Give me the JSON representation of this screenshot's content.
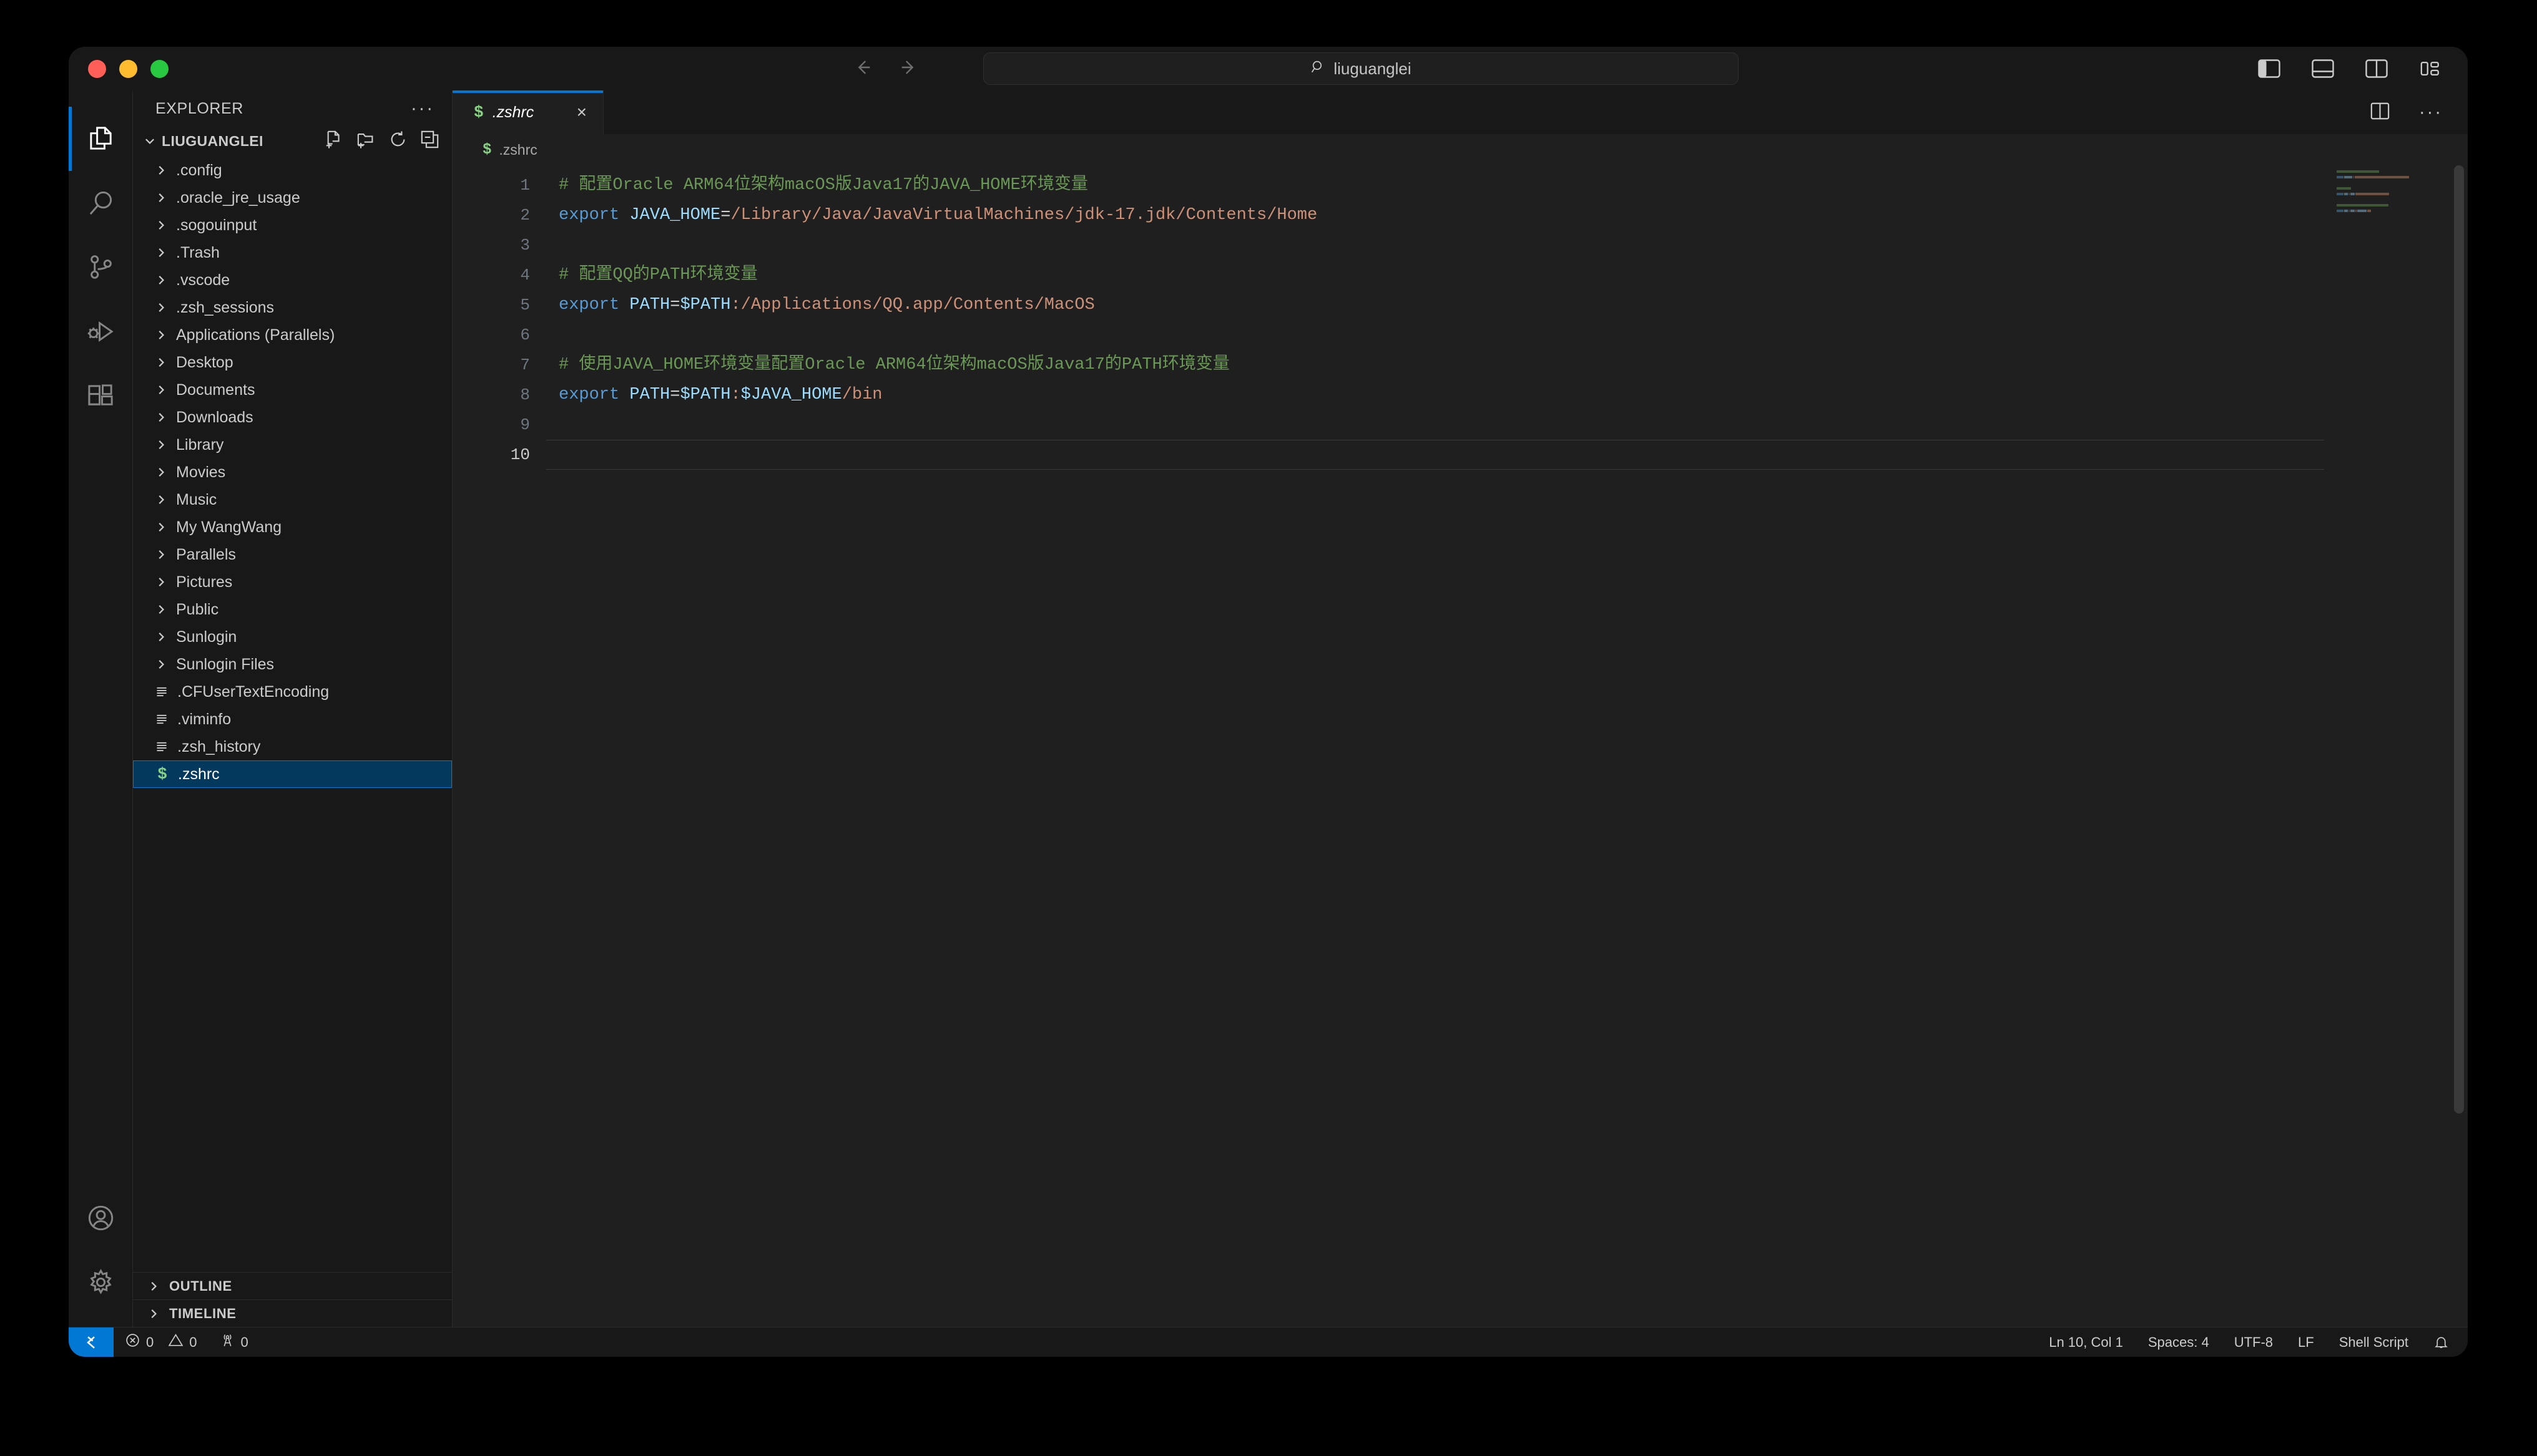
{
  "window": {
    "traffic_lights": [
      "close",
      "minimize",
      "maximize"
    ],
    "colors": {
      "close": "#ff5f57",
      "minimize": "#febc2e",
      "maximize": "#28c840",
      "accent": "#0078d4",
      "selection": "#04395e"
    }
  },
  "titlebar": {
    "back_icon": "arrow-left-icon",
    "forward_icon": "arrow-right-icon",
    "search": {
      "icon": "search-icon",
      "value": "liuguanglei"
    },
    "layout_buttons": [
      {
        "name": "toggle-primary-sidebar",
        "active": true
      },
      {
        "name": "toggle-panel",
        "active": false
      },
      {
        "name": "toggle-secondary-sidebar",
        "active": false
      },
      {
        "name": "customize-layout",
        "active": false
      }
    ]
  },
  "activitybar": {
    "items": [
      {
        "name": "explorer",
        "icon": "files-icon",
        "active": true
      },
      {
        "name": "search",
        "icon": "search-icon",
        "active": false
      },
      {
        "name": "source-control",
        "icon": "source-control-icon",
        "active": false
      },
      {
        "name": "run-and-debug",
        "icon": "debug-icon",
        "active": false
      },
      {
        "name": "extensions",
        "icon": "extensions-icon",
        "active": false
      }
    ],
    "bottom": [
      {
        "name": "accounts",
        "icon": "account-icon"
      },
      {
        "name": "manage",
        "icon": "gear-icon"
      }
    ]
  },
  "sidebar": {
    "title": "EXPLORER",
    "more_actions": "···",
    "folder": {
      "name": "LIUGUANGLEI",
      "expanded": true,
      "actions": [
        {
          "name": "new-file",
          "icon": "new-file-icon"
        },
        {
          "name": "new-folder",
          "icon": "new-folder-icon"
        },
        {
          "name": "refresh-explorer",
          "icon": "refresh-icon"
        },
        {
          "name": "collapse-folders",
          "icon": "collapse-all-icon"
        }
      ]
    },
    "items": [
      {
        "label": ".config",
        "type": "folder",
        "selected": false
      },
      {
        "label": ".oracle_jre_usage",
        "type": "folder",
        "selected": false
      },
      {
        "label": ".sogouinput",
        "type": "folder",
        "selected": false
      },
      {
        "label": ".Trash",
        "type": "folder",
        "selected": false
      },
      {
        "label": ".vscode",
        "type": "folder",
        "selected": false
      },
      {
        "label": ".zsh_sessions",
        "type": "folder",
        "selected": false
      },
      {
        "label": "Applications (Parallels)",
        "type": "folder",
        "selected": false
      },
      {
        "label": "Desktop",
        "type": "folder",
        "selected": false
      },
      {
        "label": "Documents",
        "type": "folder",
        "selected": false
      },
      {
        "label": "Downloads",
        "type": "folder",
        "selected": false
      },
      {
        "label": "Library",
        "type": "folder",
        "selected": false
      },
      {
        "label": "Movies",
        "type": "folder",
        "selected": false
      },
      {
        "label": "Music",
        "type": "folder",
        "selected": false
      },
      {
        "label": "My WangWang",
        "type": "folder",
        "selected": false
      },
      {
        "label": "Parallels",
        "type": "folder",
        "selected": false
      },
      {
        "label": "Pictures",
        "type": "folder",
        "selected": false
      },
      {
        "label": "Public",
        "type": "folder",
        "selected": false
      },
      {
        "label": "Sunlogin",
        "type": "folder",
        "selected": false
      },
      {
        "label": "Sunlogin Files",
        "type": "folder",
        "selected": false
      },
      {
        "label": ".CFUserTextEncoding",
        "type": "file",
        "selected": false
      },
      {
        "label": ".viminfo",
        "type": "file",
        "selected": false
      },
      {
        "label": ".zsh_history",
        "type": "file",
        "selected": false
      },
      {
        "label": ".zshrc",
        "type": "shell",
        "selected": true
      }
    ],
    "panels": [
      {
        "label": "OUTLINE",
        "expanded": false
      },
      {
        "label": "TIMELINE",
        "expanded": false
      }
    ]
  },
  "editor": {
    "tabs": [
      {
        "label": ".zshrc",
        "icon": "shell-file-icon",
        "active": true,
        "preview": true,
        "close": "×"
      }
    ],
    "actions": [
      {
        "name": "split-editor-right",
        "icon": "split-editor-icon"
      },
      {
        "name": "more-editor-actions",
        "icon": "ellipsis-icon",
        "label": "···"
      }
    ],
    "breadcrumb": {
      "icon": "shell-file-icon",
      "path": ".zshrc"
    },
    "line_numbers": [
      "1",
      "2",
      "3",
      "4",
      "5",
      "6",
      "7",
      "8",
      "9",
      "10"
    ],
    "active_line": 10,
    "lines": [
      {
        "n": 1,
        "tokens": [
          {
            "t": "# 配置Oracle ARM64位架构macOS版Java17的JAVA_HOME环境变量",
            "c": "comment"
          }
        ]
      },
      {
        "n": 2,
        "tokens": [
          {
            "t": "export ",
            "c": "keyword"
          },
          {
            "t": "JAVA_HOME",
            "c": "var"
          },
          {
            "t": "=",
            "c": "op"
          },
          {
            "t": "/Library/Java/JavaVirtualMachines/jdk-17.jdk/Contents/Home",
            "c": "string"
          }
        ]
      },
      {
        "n": 3,
        "tokens": []
      },
      {
        "n": 4,
        "tokens": [
          {
            "t": "# 配置QQ的PATH环境变量",
            "c": "comment"
          }
        ]
      },
      {
        "n": 5,
        "tokens": [
          {
            "t": "export ",
            "c": "keyword"
          },
          {
            "t": "PATH",
            "c": "var"
          },
          {
            "t": "=",
            "c": "op"
          },
          {
            "t": "$PATH",
            "c": "var"
          },
          {
            "t": ":/Applications/QQ.app/Contents/MacOS",
            "c": "string"
          }
        ]
      },
      {
        "n": 6,
        "tokens": []
      },
      {
        "n": 7,
        "tokens": [
          {
            "t": "# 使用JAVA_HOME环境变量配置Oracle ARM64位架构macOS版Java17的PATH环境变量",
            "c": "comment"
          }
        ]
      },
      {
        "n": 8,
        "tokens": [
          {
            "t": "export ",
            "c": "keyword"
          },
          {
            "t": "PATH",
            "c": "var"
          },
          {
            "t": "=",
            "c": "op"
          },
          {
            "t": "$PATH",
            "c": "var"
          },
          {
            "t": ":",
            "c": "string"
          },
          {
            "t": "$JAVA_HOME",
            "c": "var"
          },
          {
            "t": "/bin",
            "c": "string"
          }
        ]
      },
      {
        "n": 9,
        "tokens": []
      },
      {
        "n": 10,
        "tokens": []
      }
    ]
  },
  "statusbar": {
    "remote_icon": "remote-window-icon",
    "left": [
      {
        "name": "problems-errors",
        "icon": "error-icon",
        "value": "0"
      },
      {
        "name": "problems-warnings",
        "icon": "warning-icon",
        "value": "0"
      },
      {
        "name": "ports",
        "icon": "radio-tower-icon",
        "value": "0"
      }
    ],
    "right": [
      {
        "name": "editor-position",
        "label": "Ln 10, Col 1"
      },
      {
        "name": "editor-indentation",
        "label": "Spaces: 4"
      },
      {
        "name": "editor-encoding",
        "label": "UTF-8"
      },
      {
        "name": "editor-eol",
        "label": "LF"
      },
      {
        "name": "editor-language",
        "label": "Shell Script"
      },
      {
        "name": "notifications",
        "label": "",
        "icon": "bell-icon"
      }
    ]
  }
}
